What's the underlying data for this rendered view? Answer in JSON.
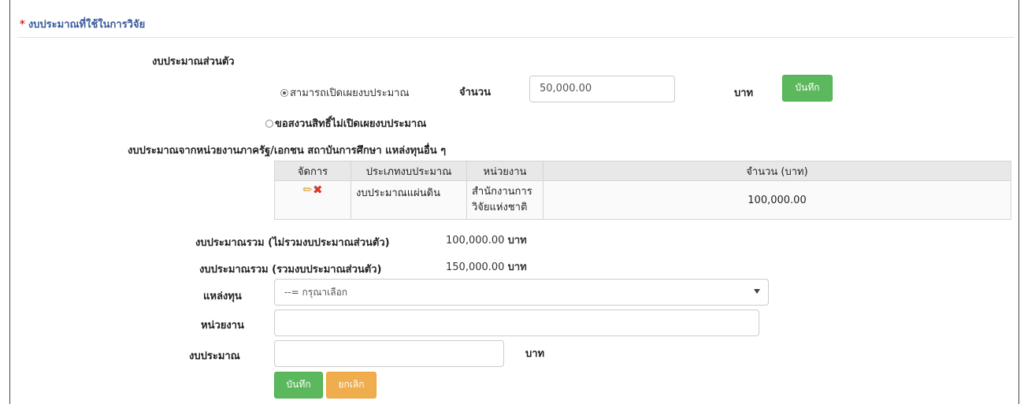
{
  "section": {
    "required_mark": "*",
    "title": "งบประมาณที่ใช้ในการวิจัย"
  },
  "personal_budget": {
    "heading": "งบประมาณส่วนตัว",
    "option_disclose": "สามารถเปิดเผยงบประมาณ",
    "amount_label": "จำนวน",
    "amount_value": "50,000.00",
    "unit": "บาท",
    "save_label": "บันทึก",
    "option_undisclose": "ขอสงวนสิทธิ์ไม่เปิดเผยงบประมาณ"
  },
  "external_budget": {
    "heading": "งบประมาณจากหน่วยงานภาครัฐ/เอกชน สถาบันการศึกษา แหล่งทุนอื่น ๆ",
    "columns": [
      "จัดการ",
      "ประเภทงบประมาณ",
      "หน่วยงาน",
      "จำนวน (บาท)"
    ],
    "rows": [
      {
        "type": "งบประมาณแผ่นดิน",
        "agency_line1": "สำนักงานการ",
        "agency_line2": "วิจัยแห่งชาติ",
        "amount": "100,000.00"
      }
    ]
  },
  "totals": {
    "excl_label": "งบประมาณรวม (ไม่รวมงบประมาณส่วนตัว)",
    "excl_value": "100,000.00",
    "incl_label": "งบประมาณรวม (รวมงบประมาณส่วนตัว)",
    "incl_value": "150,000.00",
    "unit": "บาท"
  },
  "form": {
    "source_label": "แหล่งทุน",
    "source_selected": "--= กรุณาเลือก",
    "agency_label": "หน่วยงาน",
    "agency_value": "",
    "budget_label": "งบประมาณ",
    "budget_value": "",
    "unit": "บาท",
    "save_label": "บันทึก",
    "cancel_label": "ยกเลิก"
  }
}
